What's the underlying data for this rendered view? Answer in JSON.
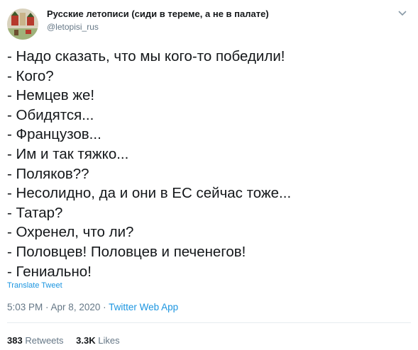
{
  "tweet": {
    "display_name": "Русские летописи (сиди в тереме, а не в палате)",
    "handle": "@letopisi_rus",
    "lines": [
      "- Надо сказать, что мы кого-то победили!",
      "- Кого?",
      "- Немцев же!",
      "- Обидятся...",
      "- Французов...",
      "- Им и так тяжко...",
      "- Поляков??",
      "- Несолидно, да и они в ЕС сейчас тоже...",
      "- Татар?",
      "- Охренел, что ли?",
      "- Половцев! Половцев и печенегов!",
      "- Гениально!"
    ],
    "translate_label": "Translate Tweet",
    "time": "5:03 PM",
    "date": "Apr 8, 2020",
    "separator": " · ",
    "source": "Twitter Web App",
    "retweets_count": "383",
    "retweets_label": "Retweets",
    "likes_count": "3.3K",
    "likes_label": "Likes"
  },
  "icons": {
    "avatar": "avatar-icon",
    "menu": "chevron-down-icon"
  },
  "colors": {
    "text": "#14171a",
    "secondary": "#657786",
    "link": "#1b95e0",
    "divider": "#e6ecf0"
  }
}
